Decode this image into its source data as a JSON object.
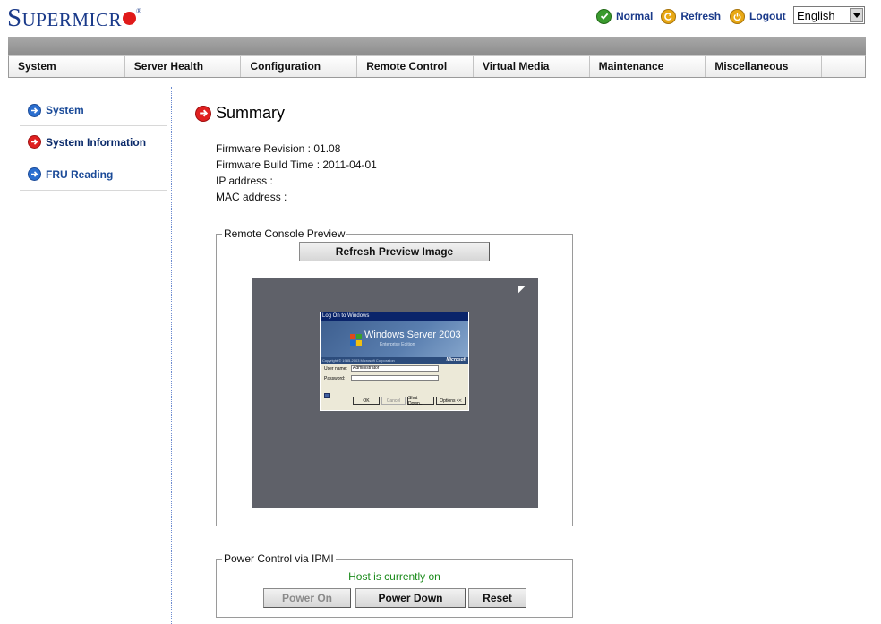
{
  "brand": {
    "logo_first": "S",
    "logo_rest": "UPERMICR",
    "registered": "®"
  },
  "header": {
    "status": "Normal",
    "refresh": "Refresh",
    "logout": "Logout",
    "language": "English"
  },
  "nav": {
    "items": [
      "System",
      "Server Health",
      "Configuration",
      "Remote Control",
      "Virtual Media",
      "Maintenance",
      "Miscellaneous"
    ]
  },
  "sidebar": {
    "items": [
      {
        "label": "System",
        "icon": "arrow-right-blue-icon"
      },
      {
        "label": "System Information",
        "icon": "arrow-right-red-icon",
        "active": true
      },
      {
        "label": "FRU Reading",
        "icon": "arrow-right-blue-icon"
      }
    ]
  },
  "main": {
    "title": "Summary",
    "firmware_revision": "Firmware Revision : 01.08",
    "firmware_build_time": "Firmware Build Time : 2011-04-01",
    "ip_address": "IP address :",
    "mac_address": "MAC address :"
  },
  "remote_console": {
    "legend": "Remote Console Preview",
    "refresh_button": "Refresh Preview Image",
    "preview": {
      "dialog_title": "Log On to Windows",
      "brand": "Windows Server 2003",
      "edition": "Enterprise Edition",
      "copyright": "Copyright © 1985-2003 Microsoft Corporation",
      "vendor": "Microsoft",
      "user_label": "User name:",
      "user_value": "Administrator",
      "password_label": "Password:",
      "buttons": [
        "OK",
        "Cancel",
        "Shut Down...",
        "Options <<"
      ]
    }
  },
  "power_control": {
    "legend": "Power Control via IPMI",
    "host_status": "Host is currently on",
    "power_on": "Power On",
    "power_down": "Power Down",
    "reset": "Reset"
  },
  "colors": {
    "brand_blue": "#1a3a8a",
    "brand_red": "#e01a1a",
    "status_green": "#1a8a1a",
    "nav_strip": "#9a9a9a",
    "preview_bg": "#5f6169"
  }
}
